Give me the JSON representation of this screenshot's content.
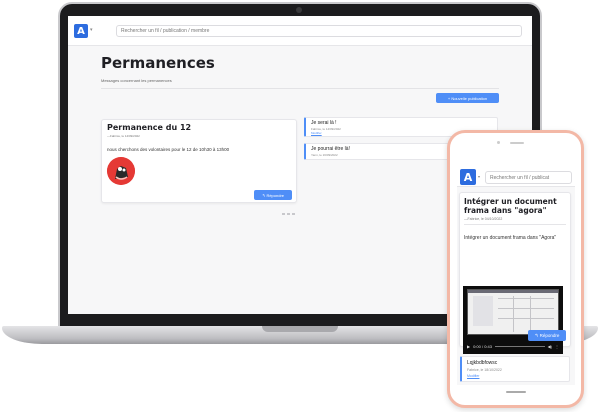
{
  "brand": {
    "accent": "#4f8ef7",
    "logo_letter": "A",
    "phone_frame": "#f3b8a6"
  },
  "laptop": {
    "search": {
      "placeholder": "Rechercher un fil / publication / membre"
    },
    "page": {
      "title": "Permanences",
      "subtitle": "Messages concernant les permanences",
      "new_button": "+ Nouvelle publication"
    },
    "main_post": {
      "title": "Permanence du 12",
      "meta": "—Fabrice, le 14/09/2022",
      "body": "nous cherchons des volontaires pour le 12 de 10h30 à 13h00",
      "reply_button": "↰ Répondre"
    },
    "side_items": [
      {
        "title": "Je serai là !",
        "meta": "Fabrice, le 14/09/2022",
        "link": "Modifier"
      },
      {
        "title": "Je pourrai être là!",
        "meta": "Yann, le 16/09/2022",
        "link": ""
      }
    ]
  },
  "phone": {
    "search": {
      "placeholder": "Rechercher un fil / publicat"
    },
    "post": {
      "title": "Intégrer un document frama dans \"agora\"",
      "meta": "—Fabrice, le 04/10/2022",
      "body": "Intégrer un document frama dans \"Agora\"",
      "reply_button": "↰ Répondre"
    },
    "video": {
      "time": "0:00 / 0:43",
      "progress": 0.0
    },
    "reply": {
      "title": "Lqjkbdbfowsc",
      "meta": "Fabrice, le 18/10/2022",
      "link": "Modifier"
    }
  }
}
